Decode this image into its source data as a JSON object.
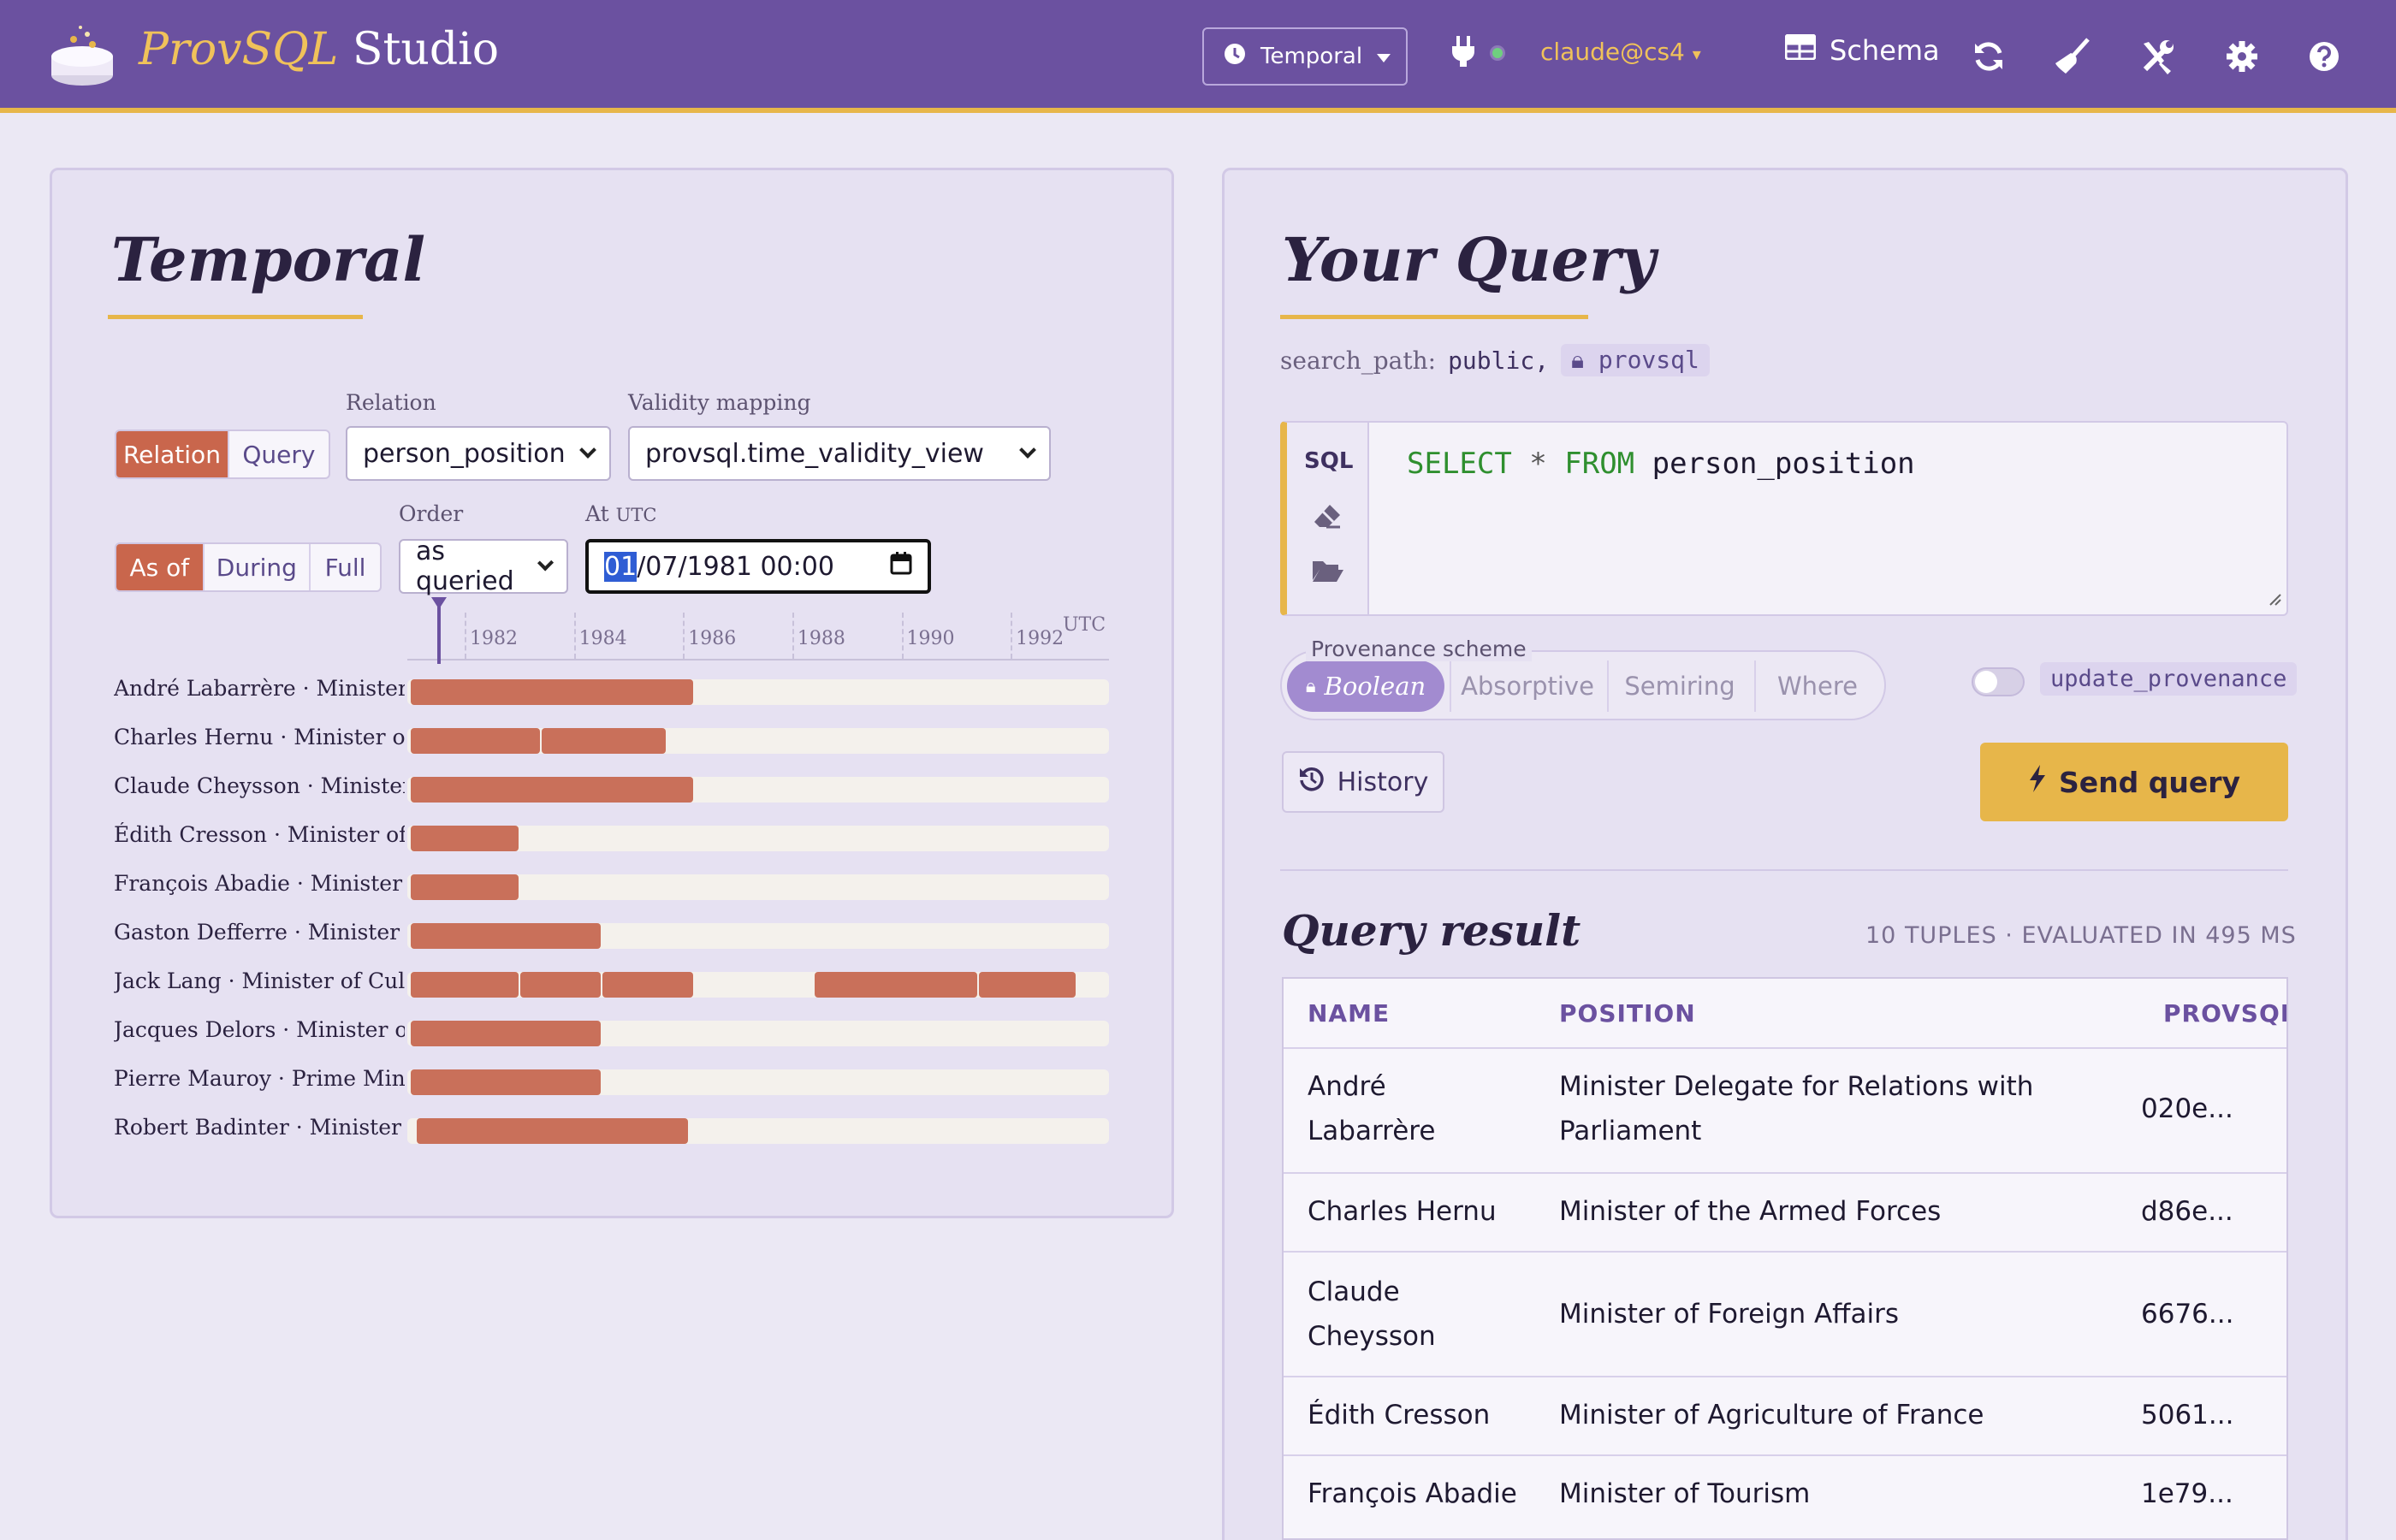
{
  "app": {
    "brand_italic": "ProvSQL",
    "brand_rest": " Studio",
    "mode": "Temporal",
    "user": "claude@cs4",
    "schema_label": "Schema",
    "colors": {
      "header": "#6b51a0",
      "accent": "#e7b64a",
      "bar": "#c9705a"
    }
  },
  "temporal": {
    "title": "Temporal",
    "source_tabs": [
      "Relation",
      "Query"
    ],
    "source_active": "Relation",
    "relation_label": "Relation",
    "relation_value": "person_position",
    "validity_label": "Validity mapping",
    "validity_value": "provsql.time_validity_view",
    "mode_tabs": [
      "As of",
      "During",
      "Full"
    ],
    "mode_active": "As of",
    "order_label": "Order",
    "order_value": "as queried",
    "at_label": "At",
    "at_unit": "UTC",
    "at_value_sel": "01",
    "at_value_rest": "/07/1981 00:00",
    "axis_unit": "UTC",
    "axis_ticks": [
      "1982",
      "1984",
      "1986",
      "1988",
      "1990",
      "1992"
    ],
    "rows": [
      {
        "label": "André Labarrère · Minister D...",
        "periods": [
          [
            "1981.0",
            "1986.2"
          ]
        ]
      },
      {
        "label": "Charles Hernu · Minister of t...",
        "periods": [
          [
            "1981.0",
            "1983.4"
          ],
          [
            "1983.4",
            "1985.7"
          ]
        ]
      },
      {
        "label": "Claude Cheysson · Minister o...",
        "periods": [
          [
            "1981.0",
            "1986.2"
          ]
        ]
      },
      {
        "label": "Édith Cresson · Minister of A...",
        "periods": [
          [
            "1981.0",
            "1983.0"
          ]
        ]
      },
      {
        "label": "François Abadie · Minister of ...",
        "periods": [
          [
            "1981.0",
            "1983.0"
          ]
        ]
      },
      {
        "label": "Gaston Defferre · Minister of ...",
        "periods": [
          [
            "1981.0",
            "1984.5"
          ]
        ]
      },
      {
        "label": "Jack Lang · Minister of Cultu...",
        "periods": [
          [
            "1981.0",
            "1983.0"
          ],
          [
            "1983.0",
            "1984.5"
          ],
          [
            "1984.5",
            "1986.2"
          ],
          [
            "1988.4",
            "1991.4"
          ],
          [
            "1991.4",
            "1993.2"
          ]
        ]
      },
      {
        "label": "Jacques Delors · Minister of t...",
        "periods": [
          [
            "1981.0",
            "1984.5"
          ]
        ]
      },
      {
        "label": "Pierre Mauroy · Prime Minist...",
        "periods": [
          [
            "1981.0",
            "1984.5"
          ]
        ]
      },
      {
        "label": "Robert Badinter · Minister of ...",
        "periods": [
          [
            "1981.1",
            "1986.1"
          ]
        ]
      }
    ]
  },
  "query": {
    "title": "Your Query",
    "search_path_label": "search_path:",
    "search_path_public": "public,",
    "search_path_provsql": "provsql",
    "sql_tag": "SQL",
    "sql_kw1": "SELECT",
    "sql_star": " * ",
    "sql_kw2": "FROM",
    "sql_rest": " person_position",
    "prov_label": "Provenance scheme",
    "prov_options": [
      "Boolean",
      "Absorptive",
      "Semiring",
      "Where"
    ],
    "prov_active": "Boolean",
    "update_label": "update_provenance",
    "history_label": "History",
    "send_label": "Send query"
  },
  "result": {
    "title": "Query result",
    "meta": "10 TUPLES · EVALUATED IN 495 MS",
    "columns": [
      "NAME",
      "POSITION",
      "PROVSQL"
    ],
    "rows": [
      {
        "name_1": "André",
        "name_2": "Labarrère",
        "position_1": "Minister Delegate for Relations with",
        "position_2": "Parliament",
        "provsql": "020e..."
      },
      {
        "name_1": "Charles Hernu",
        "name_2": "",
        "position_1": "Minister of the Armed Forces",
        "position_2": "",
        "provsql": "d86e..."
      },
      {
        "name_1": "Claude",
        "name_2": "Cheysson",
        "position_1": "Minister of Foreign Affairs",
        "position_2": "",
        "provsql": "6676..."
      },
      {
        "name_1": "Édith Cresson",
        "name_2": "",
        "position_1": "Minister of Agriculture of France",
        "position_2": "",
        "provsql": "5061..."
      },
      {
        "name_1": "François Abadie",
        "name_2": "",
        "position_1": "Minister of Tourism",
        "position_2": "",
        "provsql": "1e79..."
      }
    ]
  }
}
